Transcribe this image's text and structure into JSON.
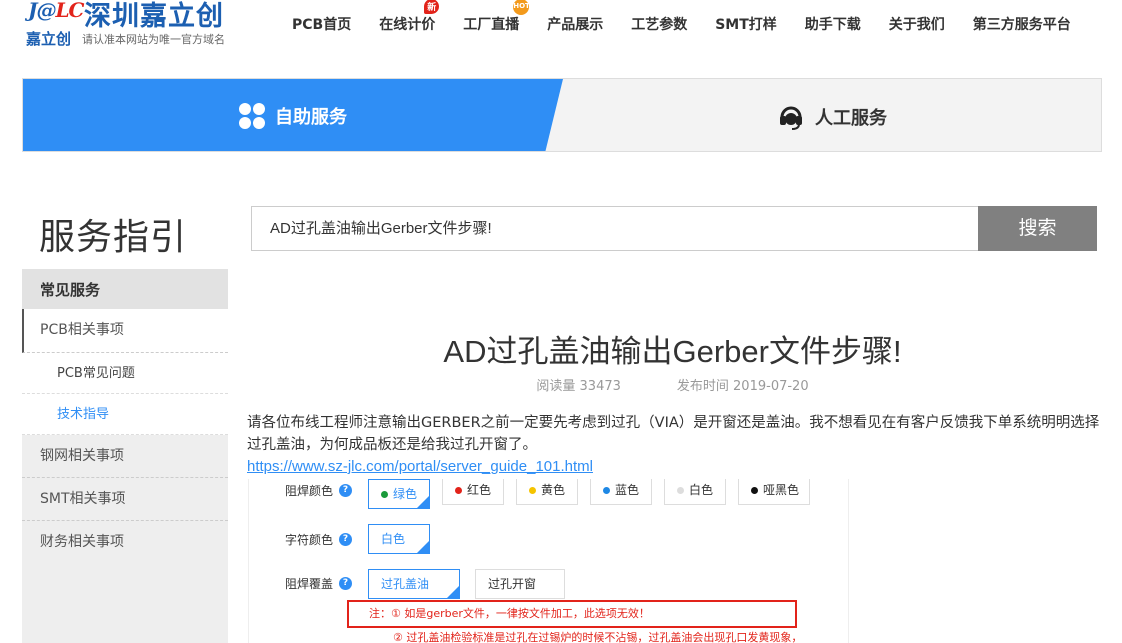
{
  "header": {
    "logo_mark_a": "J@",
    "logo_mark_b": "LC",
    "logo_cn": "深圳嘉立创",
    "logo_sub1": "嘉立创",
    "logo_sub2": "请认准本网站为唯一官方域名",
    "nav": [
      {
        "label": "PCB首页"
      },
      {
        "label": "在线计价",
        "badge": "新"
      },
      {
        "label": "工厂直播",
        "badge": "HOT"
      },
      {
        "label": "产品展示"
      },
      {
        "label": "工艺参数"
      },
      {
        "label": "SMT打样"
      },
      {
        "label": "助手下载"
      },
      {
        "label": "关于我们"
      },
      {
        "label": "第三方服务平台"
      }
    ]
  },
  "service_tabs": {
    "self": "自助服务",
    "human": "人工服务"
  },
  "sidebar": {
    "page_title": "服务指引",
    "heading": "常见服务",
    "items": [
      {
        "label": "PCB相关事项"
      },
      {
        "label": "PCB常见问题"
      },
      {
        "label": "技术指导"
      },
      {
        "label": "钢网相关事项"
      },
      {
        "label": "SMT相关事项"
      },
      {
        "label": "财务相关事项"
      }
    ]
  },
  "search": {
    "value": "AD过孔盖油输出Gerber文件步骤!",
    "button": "搜索"
  },
  "article": {
    "title": "AD过孔盖油输出Gerber文件步骤!",
    "reads": "阅读量 33473",
    "published": "发布时间 2019-07-20",
    "body": "请各位布线工程师注意输出GERBER之前一定要先考虑到过孔（VIA）是开窗还是盖油。我不想看见在有客户反馈我下单系统明明选择过孔盖油，为何成品板还是给我过孔开窗了。",
    "link": "https://www.sz-jlc.com/portal/server_guide_101.html"
  },
  "screenshot": {
    "mask_color_label": "阻焊颜色",
    "mask_colors": [
      {
        "label": "绿色",
        "color": "#1a9a3a"
      },
      {
        "label": "红色",
        "color": "#e2231a"
      },
      {
        "label": "黄色",
        "color": "#f5c400"
      },
      {
        "label": "蓝色",
        "color": "#1e88e5"
      },
      {
        "label": "白色",
        "color": "#dddddd"
      },
      {
        "label": "哑黑色",
        "color": "#111111"
      }
    ],
    "silk_color_label": "字符颜色",
    "silk_value": "白色",
    "mask_cover_label": "阻焊覆盖",
    "cover_options": [
      "过孔盖油",
      "过孔开窗"
    ],
    "note1": "注：① 如是gerber文件，一律按文件加工，此选项无效！",
    "note2": "② 过孔盖油检验标准是过孔在过锡炉的时候不沾锡，过孔盖油会出现孔口发黄现象，"
  }
}
